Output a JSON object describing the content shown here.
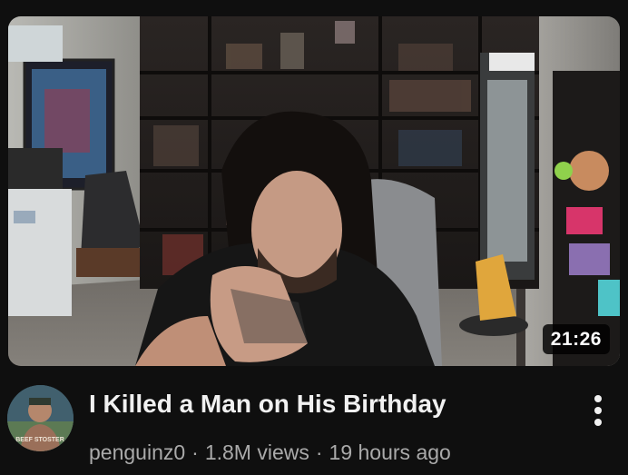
{
  "video": {
    "title": "I Killed a Man on His Birthday",
    "duration": "21:26",
    "thumbnail_icon": "video-thumbnail"
  },
  "channel": {
    "name": "penguinz0",
    "avatar_icon": "channel-avatar",
    "avatar_text": "BEEF STOSTER"
  },
  "stats": {
    "views": "1.8M views",
    "age": "19 hours ago",
    "separator": "·"
  },
  "menu": {
    "icon": "more-vertical-icon"
  },
  "colors": {
    "background": "#0f0f0f",
    "title": "#f1f1f1",
    "meta": "#aaaaaa",
    "duration_bg": "#000000"
  }
}
